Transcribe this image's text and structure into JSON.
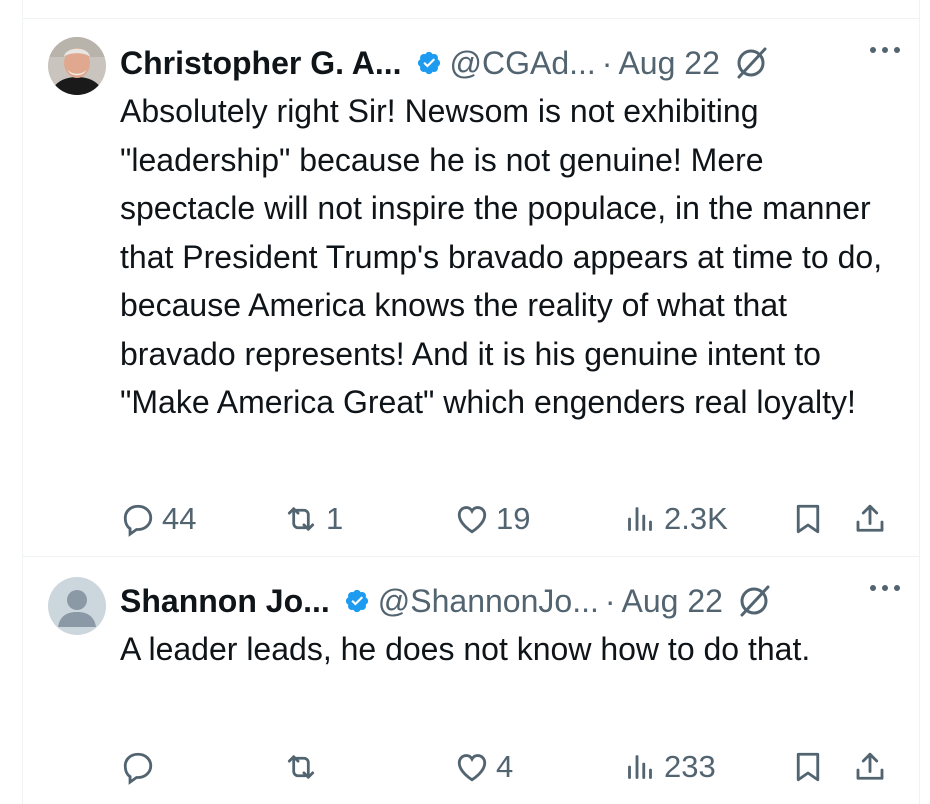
{
  "posts": [
    {
      "name": "Christopher G. A...",
      "handle": "@CGAd...",
      "separator": "·",
      "date": "Aug 22",
      "text": "Absolutely right Sir! Newsom is not exhibiting \"leadership\" because he is not genuine! Mere spectacle will not inspire the populace, in the manner that President Trump's bravado appears at time to do, because America knows the reality of what that bravado represents! And it is his genuine intent to \"Make America Great\" which engenders real loyalty!",
      "replies": "44",
      "reposts": "1",
      "likes": "19",
      "views": "2.3K"
    },
    {
      "name": "Shannon Jo...",
      "handle": "@ShannonJo...",
      "separator": "·",
      "date": "Aug 22",
      "text": "A leader leads, he does not know how to do that.",
      "replies": "",
      "reposts": "",
      "likes": "4",
      "views": "233"
    }
  ],
  "icons": {
    "verified": "verified-badge-icon",
    "grok": "grok-icon",
    "more": "more-icon",
    "reply": "reply-icon",
    "repost": "repost-icon",
    "like": "like-icon",
    "views": "views-icon",
    "bookmark": "bookmark-icon",
    "share": "share-icon"
  },
  "colors": {
    "text": "#0f1419",
    "secondary": "#536471",
    "verified": "#1d9bf0",
    "divider": "#eff3f4"
  }
}
